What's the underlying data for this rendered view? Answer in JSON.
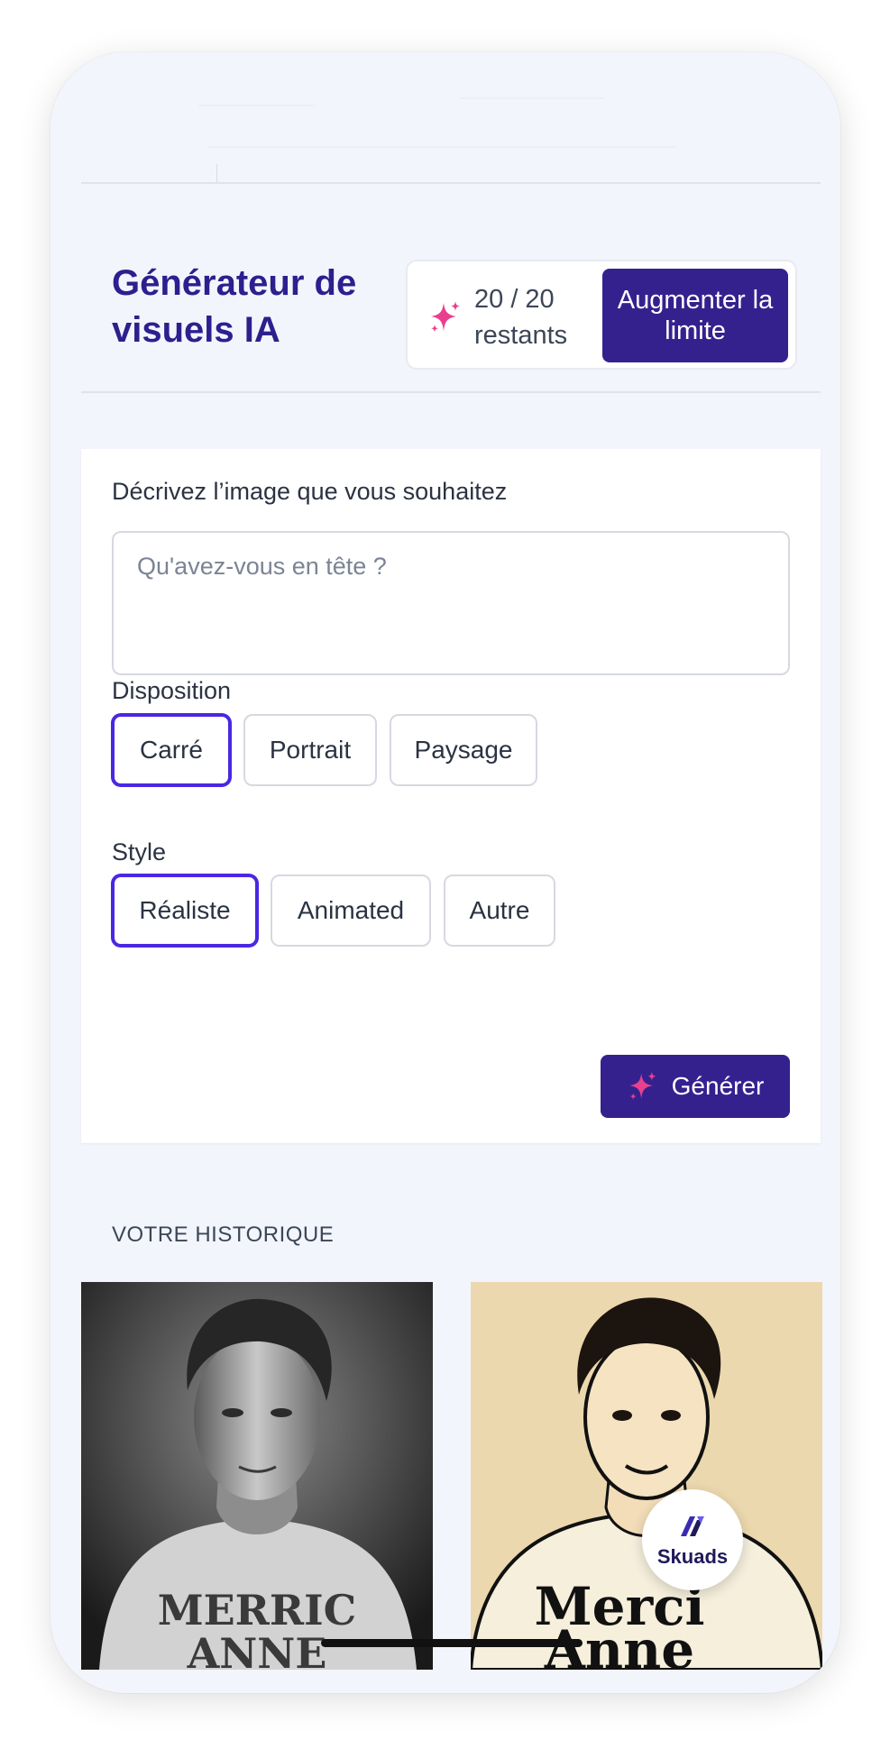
{
  "header": {
    "title": "Générateur de visuels IA",
    "quota": {
      "count": "20 / 20",
      "label": "restants"
    },
    "upgrade_label": "Augmenter la limite"
  },
  "form": {
    "prompt_label": "Décrivez l’image que vous souhaitez",
    "prompt_placeholder": "Qu'avez-vous en tête ?",
    "layout_label": "Disposition",
    "layout_options": [
      "Carré",
      "Portrait",
      "Paysage"
    ],
    "layout_selected": "Carré",
    "style_label": "Style",
    "style_options": [
      "Réaliste",
      "Animated",
      "Autre"
    ],
    "style_selected": "Réaliste",
    "generate_label": "Générer"
  },
  "history": {
    "title": "VOTRE HISTORIQUE",
    "items": [
      {
        "style": "realistic-bw",
        "shirt_text": [
          "MERRIC",
          "ANNE"
        ]
      },
      {
        "style": "illustrated",
        "shirt_text": [
          "Merci",
          "Anne"
        ]
      }
    ]
  },
  "brand": {
    "name": "Skuads"
  },
  "colors": {
    "primary": "#35218e",
    "title": "#2d1f8e",
    "selected_border": "#4a27e3",
    "sparkle": "#e8408f",
    "background": "#f3f5fc"
  },
  "icons": {
    "quota": "sparkle-icon",
    "generate": "sparkle-icon",
    "brand": "skuads-logo-icon"
  }
}
